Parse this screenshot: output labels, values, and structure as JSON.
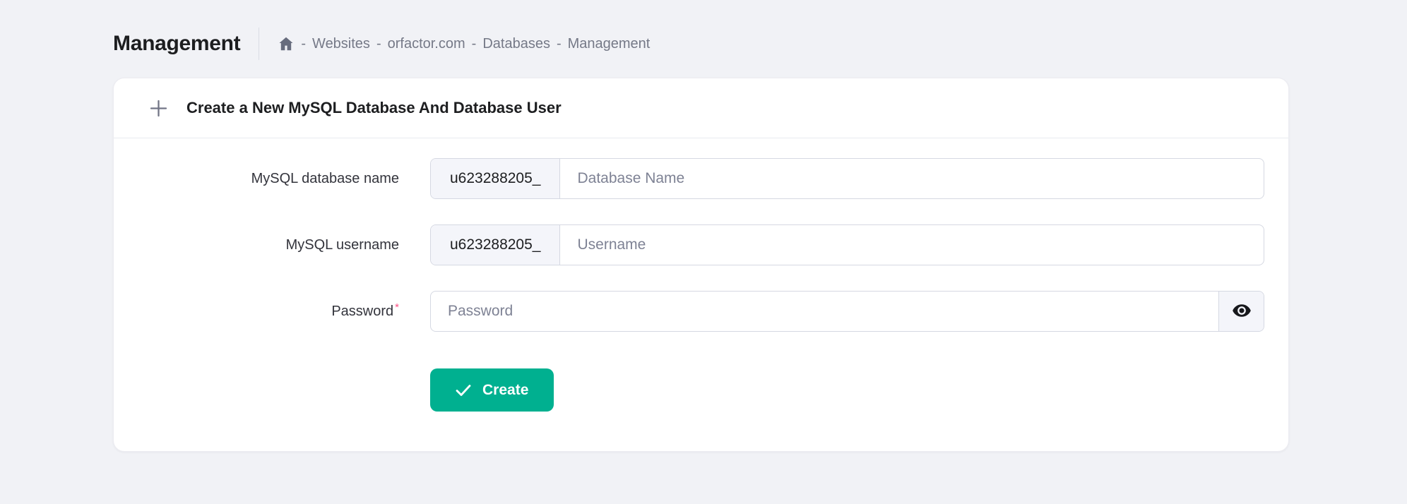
{
  "header": {
    "title": "Management",
    "breadcrumb": {
      "separator": "-",
      "items": [
        "Websites",
        "orfactor.com",
        "Databases",
        "Management"
      ]
    }
  },
  "card": {
    "header": {
      "icon": "plus-icon",
      "title": "Create a New MySQL Database And Database User"
    },
    "form": {
      "required_marker": "*",
      "fields": [
        {
          "label": "MySQL database name",
          "prefix": "u623288205_",
          "placeholder": "Database Name",
          "value": "",
          "required": false
        },
        {
          "label": "MySQL username",
          "prefix": "u623288205_",
          "placeholder": "Username",
          "value": "",
          "required": false
        },
        {
          "label": "Password",
          "placeholder": "Password",
          "value": "",
          "required": true,
          "suffix_icon": "eye-icon"
        }
      ],
      "submit": {
        "icon": "check-icon",
        "label": "Create"
      }
    }
  },
  "colors": {
    "page_background": "#f1f2f6",
    "card_background": "#ffffff",
    "accent_green": "#00b090",
    "input_border": "#d5d8e2",
    "prefix_background": "#f4f5fa",
    "text_primary": "#1d1e20",
    "text_secondary": "#757987",
    "required_red": "#fc5185"
  }
}
